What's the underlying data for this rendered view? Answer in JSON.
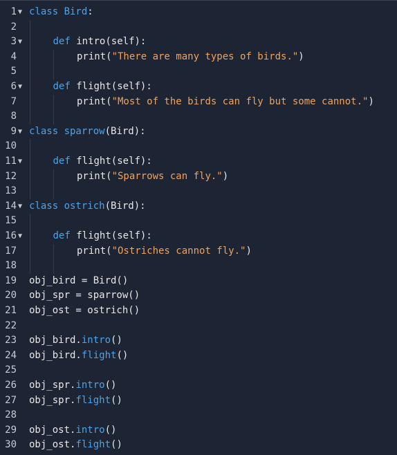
{
  "editor": {
    "lines": [
      {
        "n": "1",
        "fold": true,
        "indent": 0,
        "tokens": [
          {
            "t": "class ",
            "c": "kw"
          },
          {
            "t": "Bird",
            "c": "cls"
          },
          {
            "t": ":",
            "c": "plain"
          }
        ]
      },
      {
        "n": "2",
        "fold": false,
        "indent": 0,
        "tokens": []
      },
      {
        "n": "3",
        "fold": true,
        "indent": 1,
        "tokens": [
          {
            "t": "def ",
            "c": "kw"
          },
          {
            "t": "intro(self):",
            "c": "plain"
          }
        ]
      },
      {
        "n": "4",
        "fold": false,
        "indent": 2,
        "tokens": [
          {
            "t": "print(",
            "c": "plain"
          },
          {
            "t": "\"There are many types of birds.\"",
            "c": "str"
          },
          {
            "t": ")",
            "c": "plain"
          }
        ]
      },
      {
        "n": "5",
        "fold": false,
        "indent": 0,
        "tokens": []
      },
      {
        "n": "6",
        "fold": true,
        "indent": 1,
        "tokens": [
          {
            "t": "def ",
            "c": "kw"
          },
          {
            "t": "flight(self):",
            "c": "plain"
          }
        ]
      },
      {
        "n": "7",
        "fold": false,
        "indent": 2,
        "tokens": [
          {
            "t": "print(",
            "c": "plain"
          },
          {
            "t": "\"Most of the birds can fly but some cannot.\"",
            "c": "str"
          },
          {
            "t": ")",
            "c": "plain"
          }
        ]
      },
      {
        "n": "8",
        "fold": false,
        "indent": 0,
        "tokens": []
      },
      {
        "n": "9",
        "fold": true,
        "indent": 0,
        "tokens": [
          {
            "t": "class ",
            "c": "kw"
          },
          {
            "t": "sparrow",
            "c": "cls"
          },
          {
            "t": "(Bird):",
            "c": "plain"
          }
        ]
      },
      {
        "n": "10",
        "fold": false,
        "indent": 0,
        "tokens": []
      },
      {
        "n": "11",
        "fold": true,
        "indent": 1,
        "tokens": [
          {
            "t": "def ",
            "c": "kw"
          },
          {
            "t": "flight(self):",
            "c": "plain"
          }
        ]
      },
      {
        "n": "12",
        "fold": false,
        "indent": 2,
        "tokens": [
          {
            "t": "print(",
            "c": "plain"
          },
          {
            "t": "\"Sparrows can fly.\"",
            "c": "str"
          },
          {
            "t": ")",
            "c": "plain"
          }
        ]
      },
      {
        "n": "13",
        "fold": false,
        "indent": 0,
        "tokens": []
      },
      {
        "n": "14",
        "fold": true,
        "indent": 0,
        "tokens": [
          {
            "t": "class ",
            "c": "kw"
          },
          {
            "t": "ostrich",
            "c": "cls"
          },
          {
            "t": "(Bird):",
            "c": "plain"
          }
        ]
      },
      {
        "n": "15",
        "fold": false,
        "indent": 0,
        "tokens": []
      },
      {
        "n": "16",
        "fold": true,
        "indent": 1,
        "tokens": [
          {
            "t": "def ",
            "c": "kw"
          },
          {
            "t": "flight(self):",
            "c": "plain"
          }
        ]
      },
      {
        "n": "17",
        "fold": false,
        "indent": 2,
        "tokens": [
          {
            "t": "print(",
            "c": "plain"
          },
          {
            "t": "\"Ostriches cannot fly.\"",
            "c": "str"
          },
          {
            "t": ")",
            "c": "plain"
          }
        ]
      },
      {
        "n": "18",
        "fold": false,
        "indent": 0,
        "tokens": []
      },
      {
        "n": "19",
        "fold": false,
        "indent": 0,
        "tokens": [
          {
            "t": "obj_bird = Bird()",
            "c": "plain"
          }
        ]
      },
      {
        "n": "20",
        "fold": false,
        "indent": 0,
        "tokens": [
          {
            "t": "obj_spr = sparrow()",
            "c": "plain"
          }
        ]
      },
      {
        "n": "21",
        "fold": false,
        "indent": 0,
        "tokens": [
          {
            "t": "obj_ost = ostrich()",
            "c": "plain"
          }
        ]
      },
      {
        "n": "22",
        "fold": false,
        "indent": 0,
        "tokens": []
      },
      {
        "n": "23",
        "fold": false,
        "indent": 0,
        "tokens": [
          {
            "t": "obj_bird.",
            "c": "plain"
          },
          {
            "t": "intro",
            "c": "meth"
          },
          {
            "t": "()",
            "c": "plain"
          }
        ]
      },
      {
        "n": "24",
        "fold": false,
        "indent": 0,
        "tokens": [
          {
            "t": "obj_bird.",
            "c": "plain"
          },
          {
            "t": "flight",
            "c": "meth"
          },
          {
            "t": "()",
            "c": "plain"
          }
        ]
      },
      {
        "n": "25",
        "fold": false,
        "indent": 0,
        "tokens": []
      },
      {
        "n": "26",
        "fold": false,
        "indent": 0,
        "tokens": [
          {
            "t": "obj_spr.",
            "c": "plain"
          },
          {
            "t": "intro",
            "c": "meth"
          },
          {
            "t": "()",
            "c": "plain"
          }
        ]
      },
      {
        "n": "27",
        "fold": false,
        "indent": 0,
        "tokens": [
          {
            "t": "obj_spr.",
            "c": "plain"
          },
          {
            "t": "flight",
            "c": "meth"
          },
          {
            "t": "()",
            "c": "plain"
          }
        ]
      },
      {
        "n": "28",
        "fold": false,
        "indent": 0,
        "tokens": []
      },
      {
        "n": "29",
        "fold": false,
        "indent": 0,
        "tokens": [
          {
            "t": "obj_ost.",
            "c": "plain"
          },
          {
            "t": "intro",
            "c": "meth"
          },
          {
            "t": "()",
            "c": "plain"
          }
        ]
      },
      {
        "n": "30",
        "fold": false,
        "indent": 0,
        "tokens": [
          {
            "t": "obj_ost.",
            "c": "plain"
          },
          {
            "t": "flight",
            "c": "meth"
          },
          {
            "t": "()",
            "c": "plain"
          }
        ]
      }
    ],
    "fold_glyph": "▼",
    "colors": {
      "background": "#1d2433",
      "keyword": "#4fa3e8",
      "string": "#f0a35e",
      "text": "#e8e8e8",
      "line_number": "#c8ccd4"
    }
  }
}
